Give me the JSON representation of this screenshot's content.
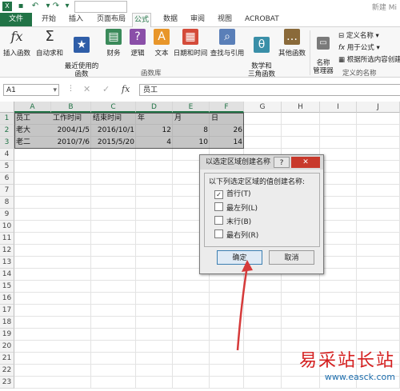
{
  "window": {
    "title": "新建 Mi",
    "qat": {
      "save_icon": "save-icon",
      "undo_icon": "undo-icon",
      "redo_icon": "redo-icon"
    }
  },
  "tabs": [
    {
      "label": "文件",
      "kind": "file"
    },
    {
      "label": "开始"
    },
    {
      "label": "插入"
    },
    {
      "label": "页面布局"
    },
    {
      "label": "公式",
      "active": true
    },
    {
      "label": "数据"
    },
    {
      "label": "审阅"
    },
    {
      "label": "视图"
    },
    {
      "label": "ACROBAT"
    }
  ],
  "ribbon": {
    "library_buttons": [
      {
        "label": "插入函数",
        "icon": "fx-icon"
      },
      {
        "label": "自动求和",
        "icon": "sigma-icon"
      },
      {
        "label": "最近使用的\n函数",
        "icon": "star-book-icon"
      },
      {
        "label": "财务",
        "icon": "finance-book-icon"
      },
      {
        "label": "逻辑",
        "icon": "logic-book-icon"
      },
      {
        "label": "文本",
        "icon": "text-book-icon"
      },
      {
        "label": "日期和时间",
        "icon": "date-book-icon"
      },
      {
        "label": "查找与引用",
        "icon": "lookup-book-icon"
      },
      {
        "label": "数学和\n三角函数",
        "icon": "math-book-icon"
      },
      {
        "label": "其他函数",
        "icon": "more-functions-icon"
      }
    ],
    "library_group_label": "函数库",
    "names": {
      "manager_label": "名称\n管理器",
      "define_name": "定义名称",
      "use_in_formula": "用于公式",
      "create_from_selection": "根据所选内容创建",
      "group_label": "定义的名称"
    }
  },
  "formula_bar": {
    "name_box": "A1",
    "fx_label": "fx",
    "content": "员工"
  },
  "sheet": {
    "columns": [
      "A",
      "B",
      "C",
      "D",
      "E",
      "F",
      "G",
      "H",
      "I",
      "J"
    ],
    "rows": [
      "1",
      "2",
      "3",
      "4",
      "5",
      "6",
      "7",
      "8",
      "9",
      "10",
      "11",
      "12",
      "13",
      "14",
      "15",
      "16",
      "17",
      "18",
      "19",
      "20",
      "21",
      "22",
      "23"
    ],
    "cells": {
      "header": [
        "员工",
        "工作时间",
        "结束时间",
        "年",
        "月",
        "日"
      ],
      "row2": [
        "老大",
        "2004/1/5",
        "2016/10/1",
        "12",
        "8",
        "26"
      ],
      "row3": [
        "老二",
        "2010/7/6",
        "2015/5/20",
        "4",
        "10",
        "14"
      ]
    }
  },
  "dialog": {
    "title": "以选定区域创建名称",
    "help_label": "?",
    "close_label": "✕",
    "group_label": "以下列选定区域的值创建名称:",
    "options": [
      {
        "label": "首行(T)",
        "checked": true
      },
      {
        "label": "最左列(L)",
        "checked": false
      },
      {
        "label": "末行(B)",
        "checked": false
      },
      {
        "label": "最右列(R)",
        "checked": false
      }
    ],
    "ok_label": "确定",
    "cancel_label": "取消"
  },
  "watermark": {
    "text": "易采站长站",
    "url": "www.easck.com"
  },
  "colors": {
    "excel_green": "#217346",
    "annotation_red": "#d63a3a",
    "watermark_red": "#d41e1e",
    "watermark_blue": "#1c6dad"
  }
}
